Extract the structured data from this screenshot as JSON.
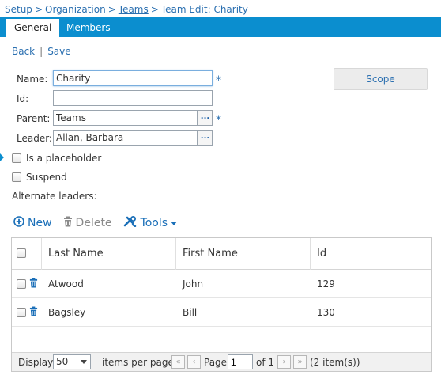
{
  "breadcrumb": {
    "setup": "Setup",
    "organization": "Organization",
    "teams": "Teams",
    "current": "Team Edit: Charity",
    "separator": ">"
  },
  "tabs": [
    {
      "label": "General",
      "active": true
    },
    {
      "label": "Members",
      "active": false
    }
  ],
  "actions": {
    "back": "Back",
    "divider": "|",
    "save": "Save"
  },
  "form": {
    "name_label": "Name:",
    "name_value": "Charity",
    "id_label": "Id:",
    "id_value": "",
    "parent_label": "Parent:",
    "parent_value": "Teams",
    "leader_label": "Leader:",
    "leader_value": "Allan, Barbara",
    "required_mark": "*",
    "lookup_button": "...",
    "placeholder_label": "Is a placeholder",
    "suspend_label": "Suspend",
    "alternate_leaders_label": "Alternate leaders:"
  },
  "scope_button": "Scope",
  "toolbar": {
    "new": "New",
    "delete": "Delete",
    "tools": "Tools"
  },
  "grid": {
    "columns": [
      "Last Name",
      "First Name",
      "Id"
    ],
    "rows": [
      {
        "last_name": "Atwood",
        "first_name": "John",
        "id": "129"
      },
      {
        "last_name": "Bagsley",
        "first_name": "Bill",
        "id": "130"
      }
    ]
  },
  "pager": {
    "display_label": "Display",
    "page_size": "50",
    "items_per_page": "items per page",
    "page_label": "Page",
    "page_value": "1",
    "of_label": "of 1",
    "item_count": "(2 item(s))"
  },
  "colors": {
    "accent": "#0b8ecf",
    "link": "#2a6fb0"
  },
  "icons": [
    "plus-circle-icon",
    "trash-icon",
    "tools-icon",
    "caret-down-icon",
    "first-page-icon",
    "prev-page-icon",
    "next-page-icon",
    "last-page-icon"
  ]
}
